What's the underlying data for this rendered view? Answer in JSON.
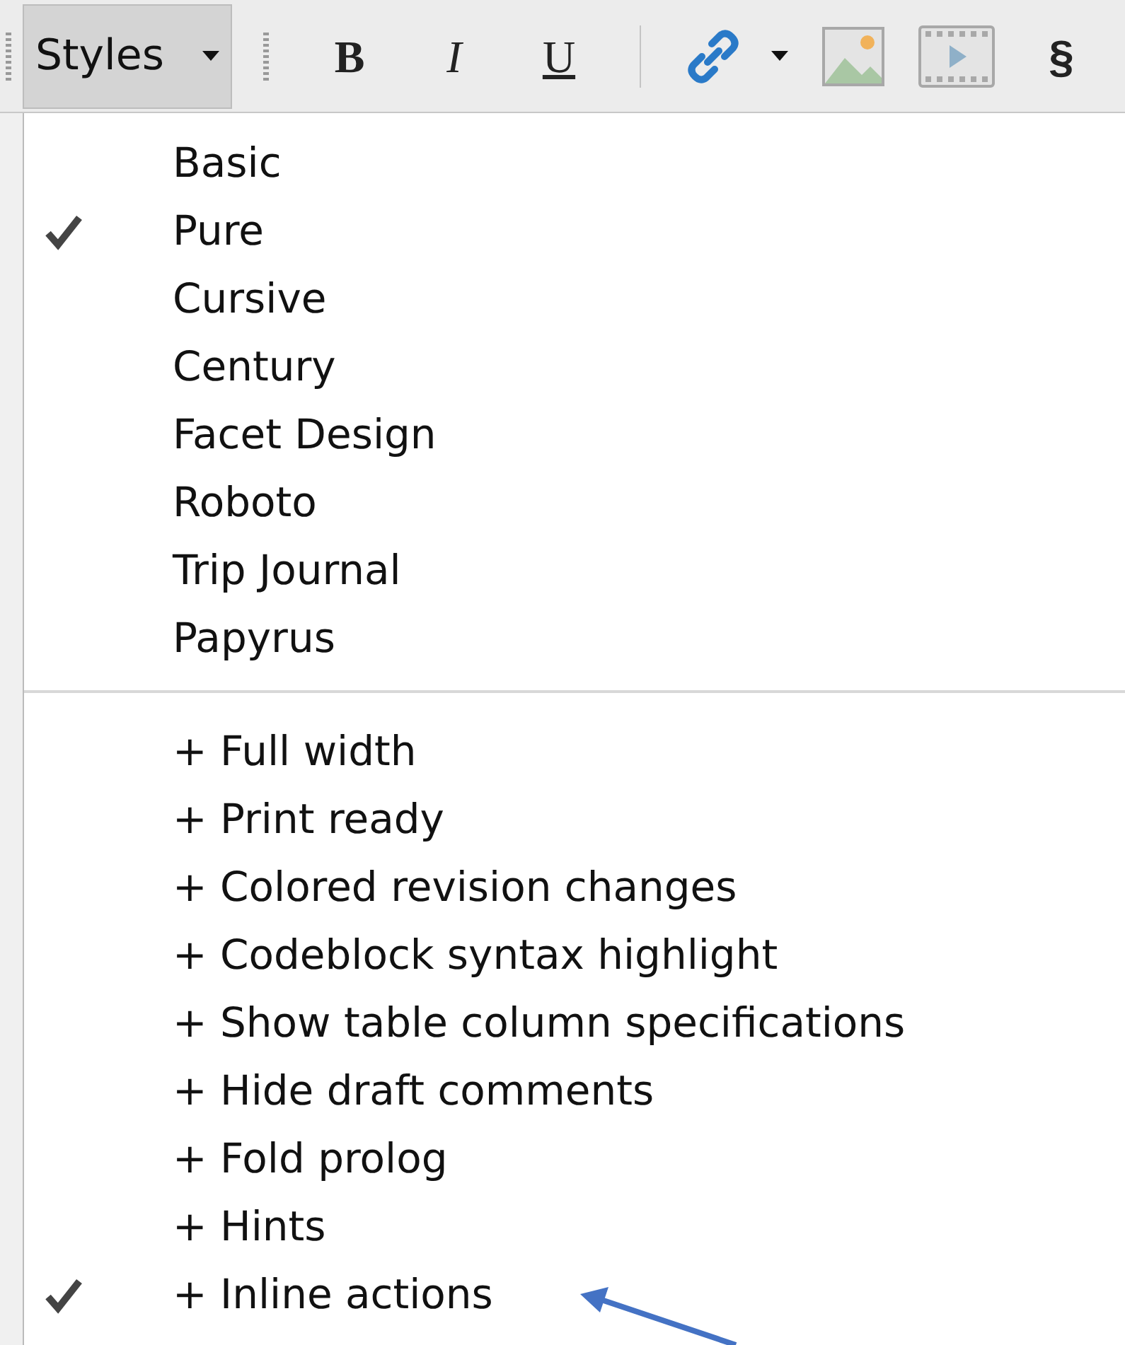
{
  "toolbar": {
    "styles_button": {
      "label": "Styles"
    },
    "buttons": [
      {
        "kind": "bold",
        "label": "B"
      },
      {
        "kind": "italic",
        "label": "I"
      },
      {
        "kind": "underline",
        "label": "U"
      },
      {
        "kind": "separator"
      },
      {
        "kind": "link"
      },
      {
        "kind": "caret"
      },
      {
        "kind": "image"
      },
      {
        "kind": "video"
      },
      {
        "kind": "plain",
        "label": "§"
      }
    ]
  },
  "menu": {
    "groups": [
      {
        "items": [
          {
            "label": "Basic",
            "checked": false
          },
          {
            "label": "Pure",
            "checked": true
          },
          {
            "label": "Cursive",
            "checked": false
          },
          {
            "label": "Century",
            "checked": false
          },
          {
            "label": "Facet Design",
            "checked": false
          },
          {
            "label": "Roboto",
            "checked": false
          },
          {
            "label": "Trip Journal",
            "checked": false
          },
          {
            "label": "Papyrus",
            "checked": false
          }
        ]
      },
      {
        "items": [
          {
            "label": "+ Full width",
            "checked": false
          },
          {
            "label": "+ Print ready",
            "checked": false
          },
          {
            "label": "+ Colored revision changes",
            "checked": false
          },
          {
            "label": "+ Codeblock syntax highlight",
            "checked": false
          },
          {
            "label": "+ Show table column specifications",
            "checked": false
          },
          {
            "label": "+ Hide draft comments",
            "checked": false
          },
          {
            "label": "+ Fold prolog",
            "checked": false
          },
          {
            "label": "+ Hints",
            "checked": false
          },
          {
            "label": "+ Inline actions",
            "checked": true
          }
        ]
      }
    ]
  }
}
